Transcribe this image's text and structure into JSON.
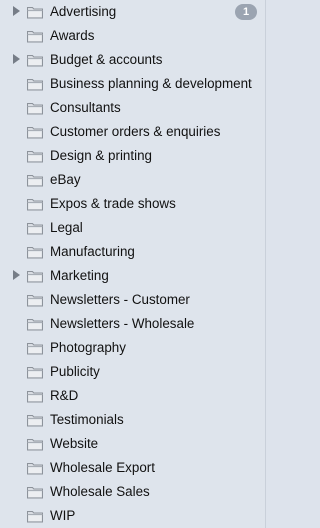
{
  "folders": [
    {
      "label": "Advertising",
      "expandable": true,
      "badge": "1"
    },
    {
      "label": "Awards",
      "expandable": false
    },
    {
      "label": "Budget & accounts",
      "expandable": true
    },
    {
      "label": "Business planning & development",
      "expandable": false
    },
    {
      "label": "Consultants",
      "expandable": false
    },
    {
      "label": "Customer orders & enquiries",
      "expandable": false
    },
    {
      "label": "Design & printing",
      "expandable": false
    },
    {
      "label": "eBay",
      "expandable": false
    },
    {
      "label": "Expos & trade shows",
      "expandable": false
    },
    {
      "label": "Legal",
      "expandable": false
    },
    {
      "label": "Manufacturing",
      "expandable": false
    },
    {
      "label": "Marketing",
      "expandable": true
    },
    {
      "label": "Newsletters - Customer",
      "expandable": false
    },
    {
      "label": "Newsletters - Wholesale",
      "expandable": false
    },
    {
      "label": "Photography",
      "expandable": false
    },
    {
      "label": "Publicity",
      "expandable": false
    },
    {
      "label": "R&D",
      "expandable": false
    },
    {
      "label": "Testimonials",
      "expandable": false
    },
    {
      "label": "Website",
      "expandable": false
    },
    {
      "label": "Wholesale Export",
      "expandable": false
    },
    {
      "label": "Wholesale Sales",
      "expandable": false
    },
    {
      "label": "WIP",
      "expandable": false
    }
  ],
  "icons": {
    "folder": "folder-icon",
    "disclosure": "disclosure-triangle-icon"
  },
  "colors": {
    "background": "#dee4ec",
    "badge": "#9ba4b1"
  }
}
